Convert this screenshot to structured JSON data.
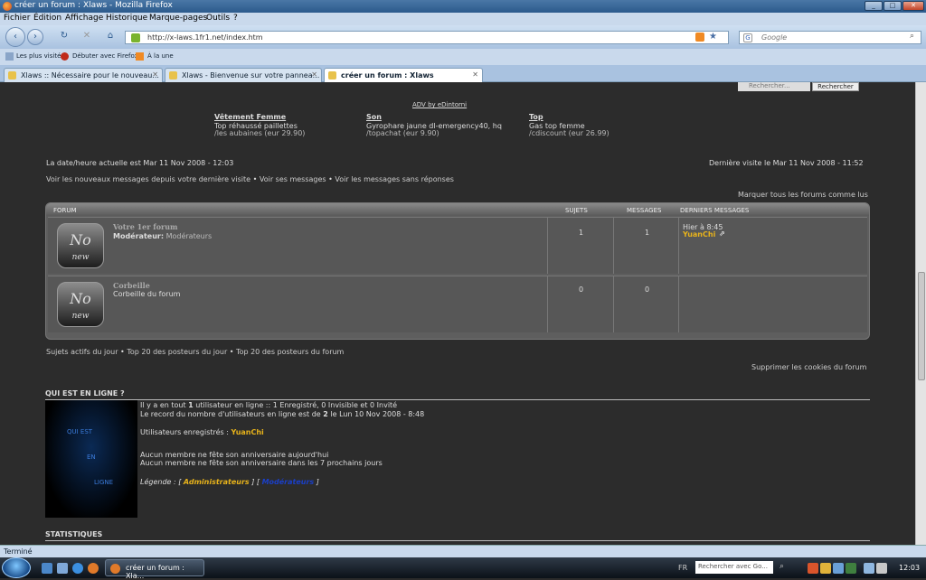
{
  "window": {
    "title": "créer un forum : Xlaws - Mozilla Firefox",
    "min": "_",
    "max": "□",
    "close": "✕"
  },
  "menu": [
    "Fichier",
    "Édition",
    "Affichage",
    "Historique",
    "Marque-pages",
    "Outils",
    "?"
  ],
  "nav": {
    "back": "‹",
    "forward": "›",
    "reload": "↻",
    "stop": "✕",
    "home": "⌂",
    "url": "http://x-laws.1fr1.net/index.htm",
    "search_placeholder": "Google"
  },
  "bookmarks": [
    "Les plus visités",
    "Débuter avec Firefox",
    "À la une"
  ],
  "tabs": [
    {
      "label": "Xlaws :: Nécessaire pour le nouveau...",
      "active": false
    },
    {
      "label": "Xlaws - Bienvenue sur votre pannea...",
      "active": false
    },
    {
      "label": "créer un forum : Xlaws",
      "active": true
    }
  ],
  "search": {
    "placeholder": "Rechercher...",
    "button": "Rechercher"
  },
  "ad": {
    "header": "ADV by eDintorni",
    "items": [
      {
        "title": "Vêtement Femme",
        "desc": "Top réhaussé paillettes",
        "meta": "/les aubaines (eur 29.90)"
      },
      {
        "title": "Son",
        "desc": "Gyrophare jaune dl-emergency40, hq",
        "meta": "/topachat (eur 9.90)"
      },
      {
        "title": "Top",
        "desc": "Gas top femme",
        "meta": "/cdiscount (eur 26.99)"
      }
    ]
  },
  "info": {
    "current_date": "La date/heure actuelle est Mar 11 Nov 2008 - 12:03",
    "last_visit": "Dernière visite le Mar 11 Nov 2008 - 11:52",
    "links": [
      "Voir les nouveaux messages depuis votre dernière visite",
      "Voir ses messages",
      "Voir les messages sans réponses"
    ],
    "mark_read": "Marquer tous les forums comme lus"
  },
  "forum_table": {
    "headers": [
      "FORUM",
      "SUJETS",
      "MESSAGES",
      "DERNIERS MESSAGES"
    ],
    "icon": {
      "top": "No",
      "bottom": "new"
    },
    "rows": [
      {
        "title": "Votre 1er forum",
        "mod_label": "Modérateur:",
        "mod_value": "Modérateurs",
        "topics": "1",
        "posts": "1",
        "last_time": "Hier à 8:45",
        "last_user": "YuanChi"
      },
      {
        "title": "Corbeille",
        "desc": "Corbeille du forum",
        "topics": "0",
        "posts": "0"
      }
    ]
  },
  "bottom_links": [
    "Sujets actifs du jour",
    "Top 20 des posteurs du jour",
    "Top 20 des posteurs du forum"
  ],
  "delete_cookies": "Supprimer les cookies du forum",
  "online": {
    "header": "QUI EST EN LIGNE ?",
    "image_text": [
      "QUI EST",
      "EN",
      "LIGNE"
    ],
    "line1_pre": "Il y a en tout",
    "line1_count": "1",
    "line1_post": "utilisateur en ligne :: 1 Enregistré, 0 Invisible et 0 Invité",
    "line2_pre": "Le record du nombre d'utilisateurs en ligne est de",
    "line2_count": "2",
    "line2_post": "le Lun 10 Nov 2008 - 8:48",
    "registered_label": "Utilisateurs enregistrés :",
    "registered_user": "YuanChi",
    "birthday_today": "Aucun membre ne fête son anniversaire aujourd'hui",
    "birthday_week": "Aucun membre ne fête son anniversaire dans les 7 prochains jours",
    "legend_label": "Légende :",
    "legend_admin": "Administrateurs",
    "legend_mod": "Modérateurs"
  },
  "stats_header": "STATISTIQUES",
  "status": "Terminé",
  "taskbar": {
    "task": "créer un forum : Xla...",
    "search": "Rechercher avec Go...",
    "lang": "FR",
    "clock": "12:03"
  },
  "colors": {
    "accent": "#e8b31b",
    "mod": "#1a3fc9",
    "page_bg": "#2c2c2c"
  }
}
